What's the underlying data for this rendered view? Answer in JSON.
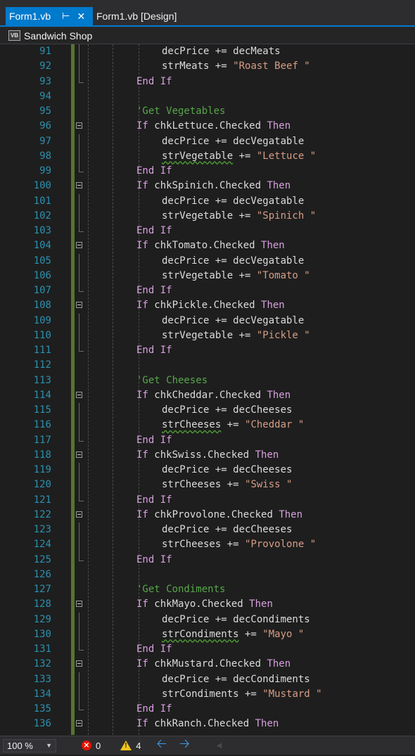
{
  "tabs": {
    "active": {
      "label": "Form1.vb",
      "pin_icon": "pin-icon",
      "close_icon": "close-icon"
    },
    "inactive": {
      "label": "Form1.vb [Design]"
    }
  },
  "navbar": {
    "icon_text": "VB",
    "title": "Sandwich Shop"
  },
  "editor": {
    "lines": [
      {
        "n": "91",
        "tokens": [
          {
            "t": "decPrice += decMeats",
            "c": "p"
          }
        ],
        "indent": 2,
        "gutter": "cont"
      },
      {
        "n": "92",
        "tokens": [
          {
            "t": "strMeats += ",
            "c": "p"
          },
          {
            "t": "\"Roast Beef \"",
            "c": "s"
          }
        ],
        "indent": 2,
        "gutter": "cont"
      },
      {
        "n": "93",
        "tokens": [
          {
            "t": "End If",
            "c": "k"
          }
        ],
        "indent": 1,
        "gutter": "end"
      },
      {
        "n": "94",
        "tokens": [],
        "indent": 1,
        "gutter": "none"
      },
      {
        "n": "95",
        "tokens": [
          {
            "t": "'Get Vegetables",
            "c": "c"
          }
        ],
        "indent": 1,
        "gutter": "none"
      },
      {
        "n": "96",
        "tokens": [
          {
            "t": "If ",
            "c": "k"
          },
          {
            "t": "chkLettuce.Checked ",
            "c": "p"
          },
          {
            "t": "Then",
            "c": "k"
          }
        ],
        "indent": 1,
        "gutter": "fold"
      },
      {
        "n": "97",
        "tokens": [
          {
            "t": "decPrice += decVegatable",
            "c": "p"
          }
        ],
        "indent": 2,
        "gutter": "cont"
      },
      {
        "n": "98",
        "tokens": [
          {
            "t": "strVegetable",
            "c": "q"
          },
          {
            "t": " += ",
            "c": "p"
          },
          {
            "t": "\"Lettuce \"",
            "c": "s"
          }
        ],
        "indent": 2,
        "gutter": "cont"
      },
      {
        "n": "99",
        "tokens": [
          {
            "t": "End If",
            "c": "k"
          }
        ],
        "indent": 1,
        "gutter": "end"
      },
      {
        "n": "100",
        "tokens": [
          {
            "t": "If ",
            "c": "k"
          },
          {
            "t": "chkSpinich.Checked ",
            "c": "p"
          },
          {
            "t": "Then",
            "c": "k"
          }
        ],
        "indent": 1,
        "gutter": "fold"
      },
      {
        "n": "101",
        "tokens": [
          {
            "t": "decPrice += decVegatable",
            "c": "p"
          }
        ],
        "indent": 2,
        "gutter": "cont"
      },
      {
        "n": "102",
        "tokens": [
          {
            "t": "strVegetable += ",
            "c": "p"
          },
          {
            "t": "\"Spinich \"",
            "c": "s"
          }
        ],
        "indent": 2,
        "gutter": "cont"
      },
      {
        "n": "103",
        "tokens": [
          {
            "t": "End If",
            "c": "k"
          }
        ],
        "indent": 1,
        "gutter": "end"
      },
      {
        "n": "104",
        "tokens": [
          {
            "t": "If ",
            "c": "k"
          },
          {
            "t": "chkTomato.Checked ",
            "c": "p"
          },
          {
            "t": "Then",
            "c": "k"
          }
        ],
        "indent": 1,
        "gutter": "fold"
      },
      {
        "n": "105",
        "tokens": [
          {
            "t": "decPrice += decVegatable",
            "c": "p"
          }
        ],
        "indent": 2,
        "gutter": "cont"
      },
      {
        "n": "106",
        "tokens": [
          {
            "t": "strVegetable += ",
            "c": "p"
          },
          {
            "t": "\"Tomato \"",
            "c": "s"
          }
        ],
        "indent": 2,
        "gutter": "cont"
      },
      {
        "n": "107",
        "tokens": [
          {
            "t": "End If",
            "c": "k"
          }
        ],
        "indent": 1,
        "gutter": "end"
      },
      {
        "n": "108",
        "tokens": [
          {
            "t": "If ",
            "c": "k"
          },
          {
            "t": "chkPickle.Checked ",
            "c": "p"
          },
          {
            "t": "Then",
            "c": "k"
          }
        ],
        "indent": 1,
        "gutter": "fold"
      },
      {
        "n": "109",
        "tokens": [
          {
            "t": "decPrice += decVegatable",
            "c": "p"
          }
        ],
        "indent": 2,
        "gutter": "cont"
      },
      {
        "n": "110",
        "tokens": [
          {
            "t": "strVegetable += ",
            "c": "p"
          },
          {
            "t": "\"Pickle \"",
            "c": "s"
          }
        ],
        "indent": 2,
        "gutter": "cont"
      },
      {
        "n": "111",
        "tokens": [
          {
            "t": "End If",
            "c": "k"
          }
        ],
        "indent": 1,
        "gutter": "end"
      },
      {
        "n": "112",
        "tokens": [],
        "indent": 1,
        "gutter": "none"
      },
      {
        "n": "113",
        "tokens": [
          {
            "t": "'Get Cheeses",
            "c": "c"
          }
        ],
        "indent": 1,
        "gutter": "none"
      },
      {
        "n": "114",
        "tokens": [
          {
            "t": "If ",
            "c": "k"
          },
          {
            "t": "chkCheddar.Checked ",
            "c": "p"
          },
          {
            "t": "Then",
            "c": "k"
          }
        ],
        "indent": 1,
        "gutter": "fold"
      },
      {
        "n": "115",
        "tokens": [
          {
            "t": "decPrice += decCheeses",
            "c": "p"
          }
        ],
        "indent": 2,
        "gutter": "cont"
      },
      {
        "n": "116",
        "tokens": [
          {
            "t": "strCheeses",
            "c": "q"
          },
          {
            "t": " += ",
            "c": "p"
          },
          {
            "t": "\"Cheddar \"",
            "c": "s"
          }
        ],
        "indent": 2,
        "gutter": "cont"
      },
      {
        "n": "117",
        "tokens": [
          {
            "t": "End If",
            "c": "k"
          }
        ],
        "indent": 1,
        "gutter": "end"
      },
      {
        "n": "118",
        "tokens": [
          {
            "t": "If ",
            "c": "k"
          },
          {
            "t": "chkSwiss.Checked ",
            "c": "p"
          },
          {
            "t": "Then",
            "c": "k"
          }
        ],
        "indent": 1,
        "gutter": "fold"
      },
      {
        "n": "119",
        "tokens": [
          {
            "t": "decPrice += decCheeses",
            "c": "p"
          }
        ],
        "indent": 2,
        "gutter": "cont"
      },
      {
        "n": "120",
        "tokens": [
          {
            "t": "strCheeses += ",
            "c": "p"
          },
          {
            "t": "\"Swiss \"",
            "c": "s"
          }
        ],
        "indent": 2,
        "gutter": "cont"
      },
      {
        "n": "121",
        "tokens": [
          {
            "t": "End If",
            "c": "k"
          }
        ],
        "indent": 1,
        "gutter": "end"
      },
      {
        "n": "122",
        "tokens": [
          {
            "t": "If ",
            "c": "k"
          },
          {
            "t": "chkProvolone.Checked ",
            "c": "p"
          },
          {
            "t": "Then",
            "c": "k"
          }
        ],
        "indent": 1,
        "gutter": "fold"
      },
      {
        "n": "123",
        "tokens": [
          {
            "t": "decPrice += decCheeses",
            "c": "p"
          }
        ],
        "indent": 2,
        "gutter": "cont"
      },
      {
        "n": "124",
        "tokens": [
          {
            "t": "strCheeses += ",
            "c": "p"
          },
          {
            "t": "\"Provolone \"",
            "c": "s"
          }
        ],
        "indent": 2,
        "gutter": "cont"
      },
      {
        "n": "125",
        "tokens": [
          {
            "t": "End If",
            "c": "k"
          }
        ],
        "indent": 1,
        "gutter": "end"
      },
      {
        "n": "126",
        "tokens": [],
        "indent": 1,
        "gutter": "none"
      },
      {
        "n": "127",
        "tokens": [
          {
            "t": "'Get Condiments",
            "c": "c"
          }
        ],
        "indent": 1,
        "gutter": "none"
      },
      {
        "n": "128",
        "tokens": [
          {
            "t": "If ",
            "c": "k"
          },
          {
            "t": "chkMayo.Checked ",
            "c": "p"
          },
          {
            "t": "Then",
            "c": "k"
          }
        ],
        "indent": 1,
        "gutter": "fold"
      },
      {
        "n": "129",
        "tokens": [
          {
            "t": "decPrice += decCondiments",
            "c": "p"
          }
        ],
        "indent": 2,
        "gutter": "cont"
      },
      {
        "n": "130",
        "tokens": [
          {
            "t": "strCondiments",
            "c": "q"
          },
          {
            "t": " += ",
            "c": "p"
          },
          {
            "t": "\"Mayo \"",
            "c": "s"
          }
        ],
        "indent": 2,
        "gutter": "cont"
      },
      {
        "n": "131",
        "tokens": [
          {
            "t": "End If",
            "c": "k"
          }
        ],
        "indent": 1,
        "gutter": "end"
      },
      {
        "n": "132",
        "tokens": [
          {
            "t": "If ",
            "c": "k"
          },
          {
            "t": "chkMustard.Checked ",
            "c": "p"
          },
          {
            "t": "Then",
            "c": "k"
          }
        ],
        "indent": 1,
        "gutter": "fold"
      },
      {
        "n": "133",
        "tokens": [
          {
            "t": "decPrice += decCondiments",
            "c": "p"
          }
        ],
        "indent": 2,
        "gutter": "cont"
      },
      {
        "n": "134",
        "tokens": [
          {
            "t": "strCondiments += ",
            "c": "p"
          },
          {
            "t": "\"Mustard \"",
            "c": "s"
          }
        ],
        "indent": 2,
        "gutter": "cont"
      },
      {
        "n": "135",
        "tokens": [
          {
            "t": "End If",
            "c": "k"
          }
        ],
        "indent": 1,
        "gutter": "end"
      },
      {
        "n": "136",
        "tokens": [
          {
            "t": "If ",
            "c": "k"
          },
          {
            "t": "chkRanch.Checked ",
            "c": "p"
          },
          {
            "t": "Then",
            "c": "k"
          }
        ],
        "indent": 1,
        "gutter": "fold"
      }
    ]
  },
  "status": {
    "zoom": "100 %",
    "errors": "0",
    "warnings": "4"
  },
  "colors": {
    "accent": "#007acc",
    "keyword": "#d8a0df",
    "string": "#d69d85",
    "comment": "#57a64a",
    "line_number": "#2b91af"
  }
}
